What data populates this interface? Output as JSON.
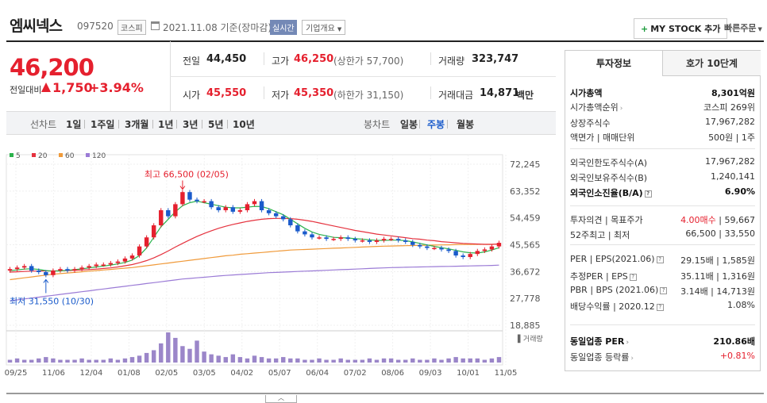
{
  "header": {
    "company_name": "엠씨넥스",
    "code": "097520",
    "market_badge": "코스피",
    "base_date": "2021.11.08 기준(장마감)",
    "realtime_label": "실시간",
    "corp_info_label": "기업개요",
    "mystock_label": "MY STOCK 추가",
    "quick_order_label": "빠른주문"
  },
  "price": {
    "current": "46,200",
    "change_label": "전일대비",
    "change_value": "1,750",
    "change_pct": "+3.94%",
    "prev_close_label": "전일",
    "prev_close": "44,450",
    "high_label": "고가",
    "high": "46,250",
    "upper_limit": "(상한가 57,700)",
    "volume_label": "거래량",
    "volume": "323,747",
    "open_label": "시가",
    "open": "45,550",
    "low_label": "저가",
    "low": "45,350",
    "lower_limit": "(하한가 31,150)",
    "amount_label": "거래대금",
    "amount": "14,871",
    "amount_unit": "백만"
  },
  "periods": {
    "line_label": "선차트",
    "line_items": [
      "1일",
      "1주일",
      "3개월",
      "1년",
      "3년",
      "5년",
      "10년"
    ],
    "candle_label": "봉차트",
    "candle_items": [
      "일봉",
      "주봉",
      "월봉"
    ],
    "selected": "주봉"
  },
  "chart_data": {
    "type": "candlestick",
    "legend": [
      {
        "name": "5",
        "color": "#2bb24c"
      },
      {
        "name": "20",
        "color": "#e5323e"
      },
      {
        "name": "60",
        "color": "#f09a3a"
      },
      {
        "name": "120",
        "color": "#9b7bd6"
      }
    ],
    "y_ticks": [
      "72,245",
      "63,352",
      "54,459",
      "45,565",
      "36,672",
      "27,778",
      "18,885"
    ],
    "y_range": [
      18885,
      72245
    ],
    "x_ticks": [
      "09/25",
      "11/06",
      "12/04",
      "01/08",
      "02/05",
      "03/05",
      "04/02",
      "05/07",
      "06/04",
      "07/02",
      "08/06",
      "09/03",
      "10/01",
      "11/05"
    ],
    "max_label": "최고 66,500 (02/05)",
    "min_label": "최저 31,550 (10/30)",
    "volume_label": "거래량",
    "close": [
      37500,
      38000,
      38500,
      37000,
      36500,
      35500,
      37000,
      37500,
      37000,
      37500,
      38000,
      38500,
      39000,
      39000,
      39500,
      40000,
      41000,
      42000,
      45000,
      48000,
      52000,
      57000,
      55000,
      59000,
      63000,
      60500,
      60000,
      60000,
      58000,
      57000,
      58000,
      56500,
      57000,
      59000,
      60000,
      57000,
      56000,
      55000,
      54000,
      52000,
      50000,
      49000,
      48000,
      48000,
      47500,
      47500,
      48000,
      47500,
      47000,
      47000,
      46500,
      47000,
      47500,
      47500,
      47000,
      46500,
      45500,
      45000,
      44500,
      44500,
      44000,
      43500,
      42000,
      41500,
      42500,
      43500,
      44000,
      45000,
      46200
    ],
    "ma5": [
      37000,
      37200,
      37500,
      37600,
      37400,
      37000,
      36800,
      36900,
      37100,
      37300,
      37600,
      37900,
      38200,
      38500,
      38800,
      39200,
      39700,
      40500,
      42000,
      44500,
      48000,
      51500,
      54000,
      56500,
      58500,
      59500,
      60000,
      59500,
      59000,
      58500,
      58000,
      57800,
      57800,
      58000,
      58300,
      58200,
      57500,
      56500,
      55500,
      54000,
      52500,
      51000,
      49800,
      49000,
      48500,
      48000,
      47900,
      47800,
      47600,
      47400,
      47200,
      47000,
      47000,
      47100,
      47100,
      46900,
      46500,
      46000,
      45500,
      45000,
      44600,
      44200,
      43700,
      43200,
      42900,
      42800,
      43200,
      43800,
      44600
    ],
    "ma20": [
      36500,
      36600,
      36700,
      36800,
      36850,
      36900,
      36900,
      36950,
      37000,
      37100,
      37200,
      37350,
      37500,
      37700,
      37900,
      38200,
      38600,
      39000,
      39600,
      40300,
      41200,
      42300,
      43500,
      44800,
      46000,
      47200,
      48300,
      49300,
      50200,
      51000,
      51700,
      52300,
      52800,
      53300,
      53700,
      54000,
      54200,
      54300,
      54300,
      54200,
      54000,
      53700,
      53300,
      52800,
      52300,
      51800,
      51300,
      50800,
      50300,
      49900,
      49500,
      49100,
      48800,
      48500,
      48200,
      47900,
      47600,
      47400,
      47100,
      46900,
      46600,
      46400,
      46200,
      46000,
      45900,
      45800,
      45700,
      45700,
      45800
    ],
    "ma60": [
      34000,
      34300,
      34600,
      34900,
      35200,
      35500,
      35800,
      36000,
      36200,
      36400,
      36600,
      36800,
      37000,
      37200,
      37400,
      37600,
      37800,
      38000,
      38300,
      38600,
      38900,
      39200,
      39500,
      39800,
      40100,
      40400,
      40700,
      41000,
      41300,
      41600,
      41900,
      42100,
      42400,
      42600,
      42800,
      43000,
      43200,
      43400,
      43600,
      43800,
      43900,
      44000,
      44100,
      44200,
      44300,
      44400,
      44500,
      44600,
      44700,
      44800,
      44900,
      45000,
      45100,
      45150,
      45200,
      45250,
      45300,
      45350,
      45400,
      45450,
      45500,
      45550,
      45600,
      45650,
      45650,
      45700,
      45700,
      45700,
      45750
    ],
    "ma120": [
      27000,
      27300,
      27600,
      27900,
      28200,
      28500,
      28800,
      29100,
      29400,
      29700,
      30000,
      30300,
      30600,
      30900,
      31200,
      31500,
      31800,
      32100,
      32400,
      32700,
      33000,
      33300,
      33600,
      33900,
      34200,
      34400,
      34600,
      34800,
      35000,
      35200,
      35400,
      35550,
      35700,
      35850,
      36000,
      36150,
      36300,
      36400,
      36500,
      36600,
      36700,
      36800,
      36900,
      37000,
      37100,
      37200,
      37300,
      37400,
      37500,
      37600,
      37700,
      37800,
      37900,
      38000,
      38050,
      38100,
      38150,
      38200,
      38250,
      38300,
      38350,
      38400,
      38450,
      38500,
      38550,
      38600,
      38650,
      38700,
      38800
    ],
    "volume": [
      2,
      3,
      2,
      2,
      3,
      4,
      3,
      2,
      2,
      2,
      3,
      2,
      2,
      2,
      3,
      2,
      3,
      4,
      5,
      7,
      9,
      14,
      22,
      18,
      12,
      10,
      16,
      8,
      6,
      5,
      4,
      6,
      4,
      3,
      5,
      4,
      3,
      3,
      4,
      3,
      3,
      2,
      2,
      3,
      2,
      2,
      3,
      2,
      2,
      2,
      3,
      2,
      3,
      3,
      2,
      2,
      3,
      2,
      2,
      3,
      2,
      3,
      4,
      3,
      3,
      3,
      2,
      3,
      4
    ]
  },
  "right_panel": {
    "tab_active": "투자정보",
    "tab_inactive": "호가 10단계",
    "rows": [
      {
        "k": "시가총액",
        "v": "8,301억원",
        "bold": true
      },
      {
        "k": "시가총액순위",
        "v": "코스피 269위",
        "arrow": true
      },
      {
        "k": "상장주식수",
        "v": "17,967,282"
      },
      {
        "k": "액면가 | 매매단위",
        "v": "500원 | 1주"
      },
      {
        "k": "외국인한도주식수(A)",
        "v": "17,967,282"
      },
      {
        "k": "외국인보유주식수(B)",
        "v": "1,240,141"
      },
      {
        "k": "외국인소진율(B/A)",
        "v": "6.90%",
        "bold": true,
        "q": true
      },
      {
        "k": "투자의견 | 목표주가",
        "v_red": "4.00매수",
        "v": "59,667"
      },
      {
        "k": "52주최고 | 최저",
        "v": "66,500 | 33,550"
      },
      {
        "k": "PER | EPS(2021.06)",
        "v": "29.15배 | 1,585원",
        "q": true
      },
      {
        "k": "추정PER | EPS",
        "v": "35.11배 | 1,316원",
        "q": true
      },
      {
        "k": "PBR | BPS (2021.06)",
        "v": "3.14배 | 14,713원",
        "q": true
      },
      {
        "k": "배당수익률 | 2020.12",
        "v": "1.08%",
        "q": true
      },
      {
        "k": "동일업종 PER",
        "v": "210.86배",
        "bold": true,
        "arrow": true
      },
      {
        "k": "동일업종 등락률",
        "v": "+0.81%",
        "arrow": true,
        "red": true
      }
    ]
  }
}
